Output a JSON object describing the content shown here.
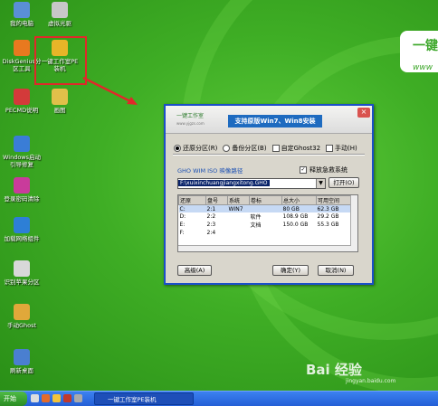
{
  "desktop_icons": [
    {
      "label": "我的电脑",
      "color": "#5a8fd6"
    },
    {
      "label": "虚拟光驱",
      "color": "#c7c7c7"
    },
    {
      "label": "DiskGenius分区工具",
      "color": "#e8791f"
    },
    {
      "label": "一键工作室PE装机",
      "color": "#e7b528"
    },
    {
      "label": "PECMD说明",
      "color": "#d33a3a"
    },
    {
      "label": "画图",
      "color": "#e0c04a"
    },
    {
      "label": "Windows启动引导修复",
      "color": "#3a7dd6"
    },
    {
      "label": "登录密码清除",
      "color": "#c93b9b"
    },
    {
      "label": "加载网络组件",
      "color": "#2d7fd6"
    },
    {
      "label": "识别苹果分区",
      "color": "#d8d8d8"
    },
    {
      "label": "手动Ghost",
      "color": "#e0a83a"
    },
    {
      "label": "刷新桌面",
      "color": "#4a7fd0"
    }
  ],
  "brand": {
    "title": "一键",
    "sub": "www"
  },
  "window": {
    "logo_text": "一键工作室",
    "logo_url": "www.yjgzs.com",
    "banner": "支持原版Win7、Win8安装",
    "close": "×",
    "options": {
      "restore": "还原分区(R)",
      "backup": "备份分区(B)",
      "ghost32": "自定Ghost32",
      "manual": "手动(H)"
    },
    "image_title": "GHO WIM ISO 映像路径",
    "release_restore": "释放急救系统",
    "image_path": "F:\\xuixinchuangjiangxitong.GHO",
    "open_button": "打开(O)",
    "table": {
      "headers": [
        "还原",
        "盘号",
        "系统",
        "卷标",
        "总大小",
        "可用空间"
      ],
      "rows": [
        [
          "C:",
          "2:1",
          "WIN7",
          "",
          "80 GB",
          "62.3 GB"
        ],
        [
          "D:",
          "2:2",
          "",
          "软件",
          "108.9 GB",
          "29.2 GB"
        ],
        [
          "E:",
          "2:3",
          "",
          "文档",
          "150.0 GB",
          "55.3 GB"
        ],
        [
          "F:",
          "2:4",
          "",
          "",
          "",
          ""
        ]
      ]
    },
    "adv_button": "高级(A)",
    "ok_button": "确定(Y)",
    "cancel_button": "取消(N)"
  },
  "taskbar": {
    "start": "开始",
    "task": "一键工作室PE装机"
  },
  "watermark": {
    "text": "Bai 经验",
    "sub": "jingyan.baidu.com"
  }
}
